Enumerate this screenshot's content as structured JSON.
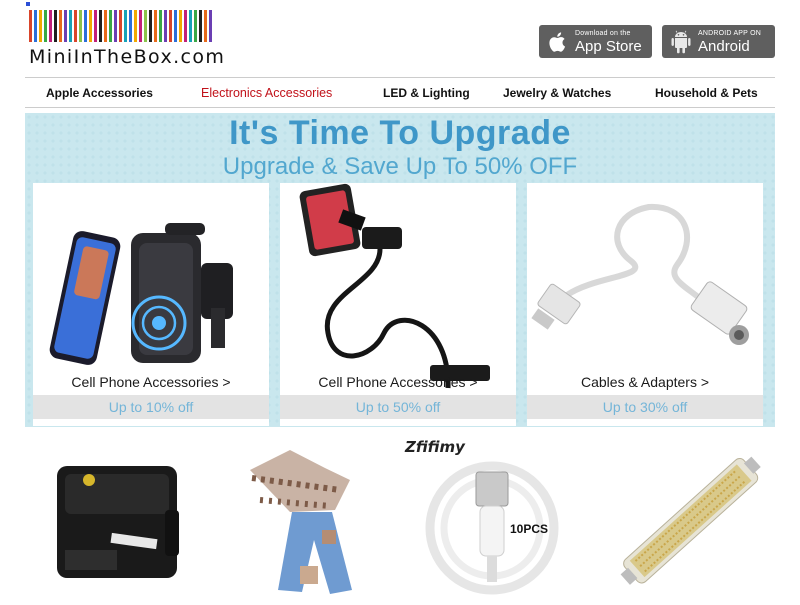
{
  "header": {
    "logo_text": "MiniInTheBox.com",
    "logo_bar_colors": [
      "#d9452b",
      "#2b6fd9",
      "#f2a900",
      "#39a845",
      "#c21f7a",
      "#1f1f1f",
      "#e86a1a",
      "#6b3fb3",
      "#17a2b8",
      "#d9452b",
      "#8bc34a",
      "#2b6fd9",
      "#f2a900",
      "#c21f7a",
      "#1f1f1f",
      "#e86a1a",
      "#39a845",
      "#6b3fb3",
      "#d9452b",
      "#17a2b8",
      "#2b6fd9",
      "#f2a900",
      "#c21f7a",
      "#8bc34a",
      "#1f1f1f",
      "#e86a1a",
      "#39a845",
      "#6b3fb3",
      "#d9452b",
      "#2b6fd9",
      "#f2a900",
      "#c21f7a",
      "#17a2b8",
      "#39a845",
      "#1f1f1f",
      "#e86a1a",
      "#6b3fb3"
    ],
    "app_store": {
      "small": "Download on the",
      "big": "App Store",
      "icon": "apple-icon"
    },
    "android": {
      "small": "ANDROID APP ON",
      "big": "Android",
      "icon": "android-icon"
    }
  },
  "nav": {
    "items": [
      {
        "label": "Apple Accessories"
      },
      {
        "label": "Electronics Accessories"
      },
      {
        "label": "LED & Lighting"
      },
      {
        "label": "Jewelry & Watches"
      },
      {
        "label": "Household & Pets"
      }
    ],
    "active_index": 1,
    "active_color": "#c1121a"
  },
  "banner": {
    "title": "It's Time To Upgrade",
    "subtitle": "Upgrade & Save Up To 50% OFF",
    "background": "#c9e7ee",
    "cards": [
      {
        "label": "Cell Phone Accessories >",
        "deal": "Up to 10% off",
        "image": "wireless-car-charger-image"
      },
      {
        "label": "Cell Phone Accessories >",
        "deal": "Up to 50% off",
        "image": "gooseneck-phone-holder-image"
      },
      {
        "label": "Cables & Adapters >",
        "deal": "Up to 30% off",
        "image": "audio-adapter-cable-image"
      }
    ]
  },
  "products": {
    "brand_label": "Zfifimy",
    "items": [
      {
        "image": "black-box-device-image"
      },
      {
        "image": "kids-outfit-image"
      },
      {
        "image": "usb-cable-image",
        "badge": "10PCS"
      },
      {
        "image": "led-bulb-image"
      }
    ]
  }
}
